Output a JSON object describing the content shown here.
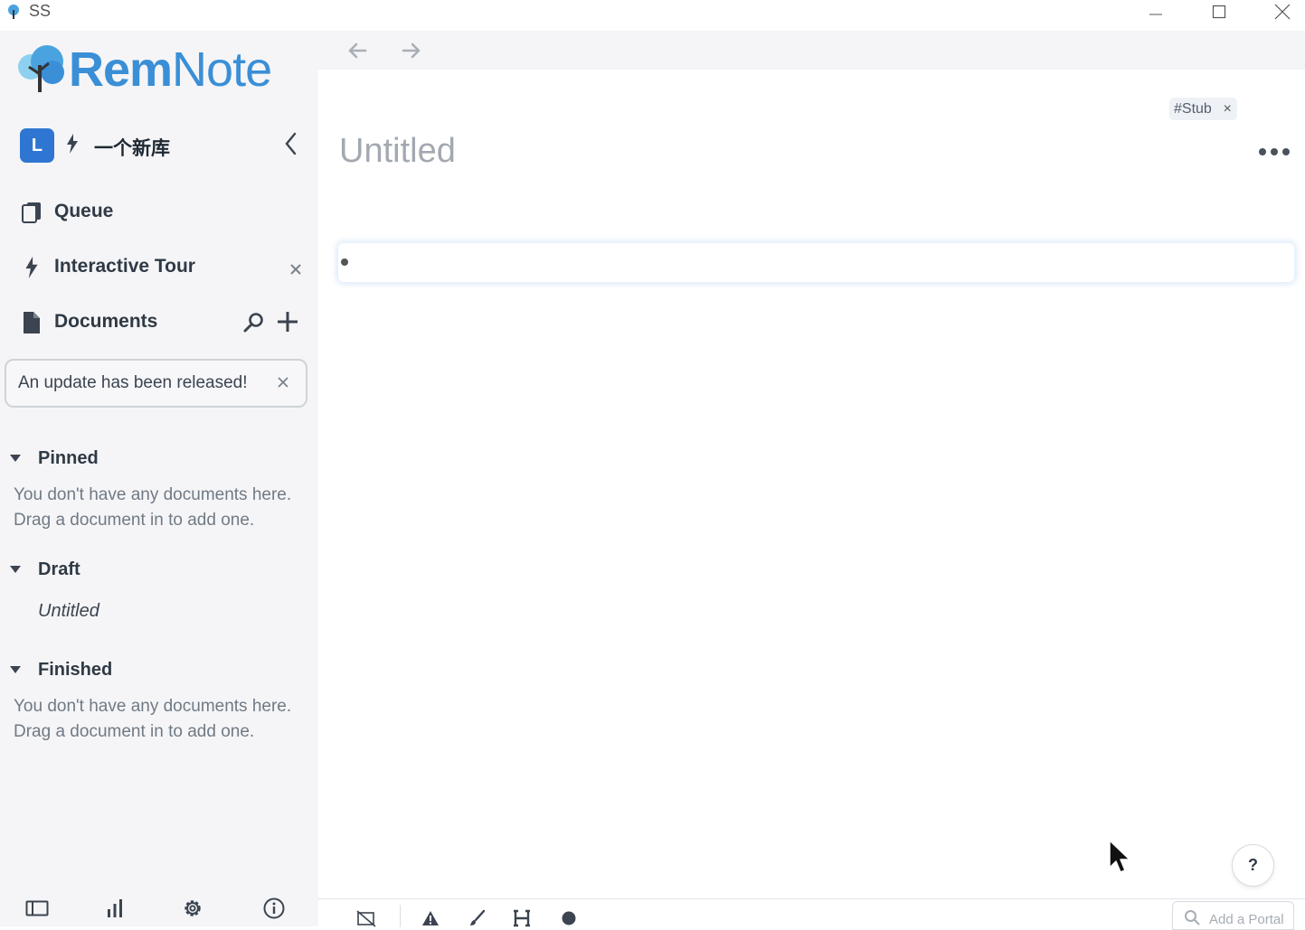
{
  "window": {
    "title": "SS"
  },
  "brand": {
    "name_bold": "Rem",
    "name_thin": "Note",
    "color": "#3a8fd6"
  },
  "knowledge_base": {
    "avatar_letter": "L",
    "name": "一个新库"
  },
  "nav": {
    "queue": "Queue",
    "interactive_tour": "Interactive Tour",
    "documents": "Documents"
  },
  "update_notice": {
    "text": "An update has been released!",
    "close": "×"
  },
  "sections": {
    "pinned": {
      "title": "Pinned",
      "empty_line1": "You don't have any documents here.",
      "empty_line2": "Drag a document in to add one."
    },
    "draft": {
      "title": "Draft",
      "items": [
        "Untitled"
      ]
    },
    "finished": {
      "title": "Finished",
      "empty_line1": "You don't have any documents here.",
      "empty_line2": "Drag a document in to add one."
    }
  },
  "document": {
    "tag": "#Stub",
    "tag_close": "×",
    "title_placeholder": "Untitled"
  },
  "help": {
    "label": "?"
  },
  "portal": {
    "placeholder": "Add a Portal"
  },
  "icons": {
    "back": "arrow-left-icon",
    "forward": "arrow-right-icon",
    "queue": "cards-icon",
    "tour": "lightning-icon",
    "documents": "document-icon",
    "search": "search-icon",
    "add": "plus-icon"
  }
}
